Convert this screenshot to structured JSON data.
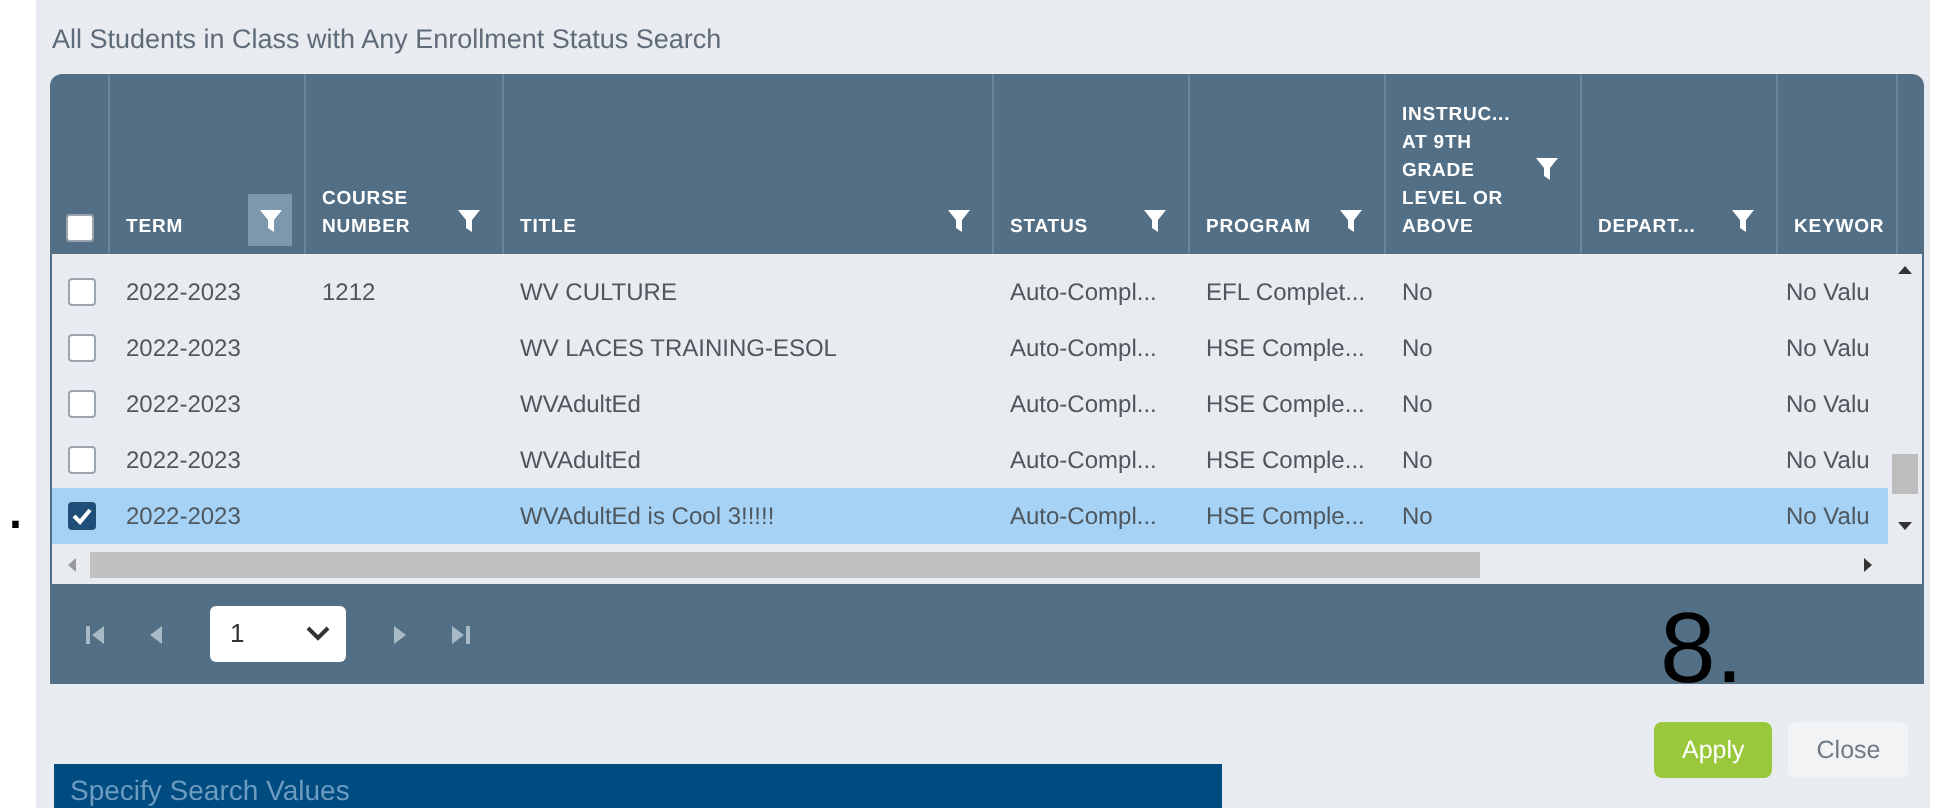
{
  "panel": {
    "title": "All Students in Class with Any Enrollment Status Search"
  },
  "table": {
    "select_all": {
      "checked": false
    },
    "columns": [
      {
        "label": "TERM",
        "filter": true,
        "active": true
      },
      {
        "label": "COURSE NUMBER",
        "filter": true,
        "active": false
      },
      {
        "label": "TITLE",
        "filter": true,
        "active": false
      },
      {
        "label": "STATUS",
        "filter": true,
        "active": false
      },
      {
        "label": "PROGRAM",
        "filter": true,
        "active": false
      },
      {
        "label": "INSTRUC... AT 9TH GRADE LEVEL OR ABOVE",
        "filter": true,
        "active": false
      },
      {
        "label": "DEPART...",
        "filter": true,
        "active": false
      },
      {
        "label": "KEYWOR",
        "filter": false,
        "active": false
      }
    ],
    "rows": [
      {
        "selected": false,
        "cells": [
          "2022-2023",
          "1212",
          "WV CULTURE",
          "Auto-Compl...",
          "EFL Complet...",
          "No",
          "",
          "No Valu"
        ]
      },
      {
        "selected": false,
        "cells": [
          "2022-2023",
          "",
          "WV LACES TRAINING-ESOL",
          "Auto-Compl...",
          "HSE Comple...",
          "No",
          "",
          "No Valu"
        ]
      },
      {
        "selected": false,
        "cells": [
          "2022-2023",
          "",
          "WVAdultEd",
          "Auto-Compl...",
          "HSE Comple...",
          "No",
          "",
          "No Valu"
        ]
      },
      {
        "selected": false,
        "cells": [
          "2022-2023",
          "",
          "WVAdultEd",
          "Auto-Compl...",
          "HSE Comple...",
          "No",
          "",
          "No Valu"
        ]
      },
      {
        "selected": true,
        "cells": [
          "2022-2023",
          "",
          "WVAdultEd is Cool 3!!!!!",
          "Auto-Compl...",
          "HSE Comple...",
          "No",
          "",
          "No Valu"
        ]
      }
    ]
  },
  "pager": {
    "page": "1"
  },
  "annotations": [
    ".",
    "8."
  ],
  "buttons": [
    {
      "label": "Apply",
      "kind": "primary"
    },
    {
      "label": "Close",
      "kind": "secondary"
    }
  ],
  "section": {
    "title": "Specify Search Values"
  }
}
